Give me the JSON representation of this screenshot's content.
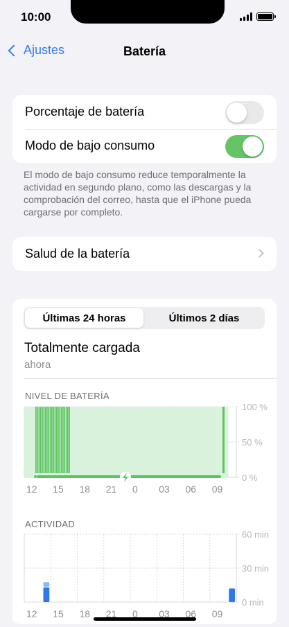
{
  "status": {
    "time": "10:00"
  },
  "nav": {
    "back_label": "Ajustes",
    "title": "Batería"
  },
  "settings": {
    "battery_percentage": {
      "label": "Porcentaje de batería",
      "on": false
    },
    "low_power_mode": {
      "label": "Modo de bajo consumo",
      "on": true
    },
    "low_power_footnote": "El modo de bajo consumo reduce temporalmente la actividad en segundo plano, como las descargas y la comprobación del correo, hasta que el iPhone pueda cargarse por completo.",
    "battery_health": {
      "label": "Salud de la batería"
    }
  },
  "usage": {
    "tabs": [
      "Últimas 24 horas",
      "Últimos 2 días"
    ],
    "selected_tab": 0,
    "status_title": "Totalmente cargada",
    "status_time": "ahora",
    "level_label": "NIVEL DE BATERÍA",
    "activity_label": "ACTIVIDAD"
  },
  "colors": {
    "accent_blue": "#3478f6",
    "toggle_green": "#65c466",
    "battery_green": "#5ac45f",
    "battery_fill": "#d9f2dc",
    "activity_blue": "#2f78e8",
    "activity_light_blue": "#86bcf5"
  },
  "chart_data": [
    {
      "type": "area",
      "title": "NIVEL DE BATERÍA",
      "x_ticks": [
        "12",
        "15",
        "18",
        "21",
        "0",
        "03",
        "06",
        "09"
      ],
      "y_ticks": [
        "100 %",
        "50 %",
        "0 %"
      ],
      "ylim": [
        0,
        100
      ],
      "unit": "%",
      "series": [
        {
          "values": [
            100,
            100,
            100,
            100,
            100,
            100,
            100,
            100
          ]
        }
      ]
    },
    {
      "type": "bar",
      "title": "ACTIVIDAD",
      "x_ticks": [
        "12",
        "15",
        "18",
        "21",
        "0",
        "03",
        "06",
        "09"
      ],
      "y_ticks": [
        "60 min",
        "30 min",
        "0 min"
      ],
      "ylim": [
        0,
        60
      ],
      "unit": "min",
      "bars": [
        {
          "hour_index": 2,
          "screen_on": 13,
          "screen_off": 4
        },
        {
          "hour_index": 23,
          "screen_on": 12,
          "screen_off": 0
        }
      ]
    }
  ]
}
